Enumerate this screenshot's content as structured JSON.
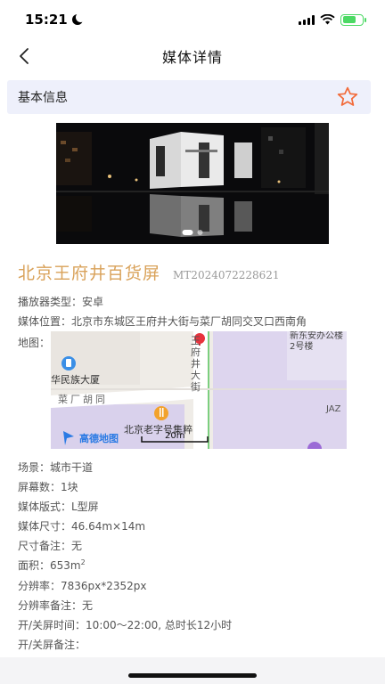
{
  "status": {
    "time": "15:21"
  },
  "nav": {
    "title": "媒体详情"
  },
  "section": {
    "title": "基本信息"
  },
  "media": {
    "name": "北京王府井百货屏",
    "code": "MT2024072228621",
    "name_color": "#d9a25a"
  },
  "info": {
    "player_type": "播放器类型：安卓",
    "location": "媒体位置：北京市东城区王府井大街与菜厂胡同交叉口西南角",
    "map_label": "地图：",
    "scene": "场景：城市干道",
    "screen_count": "屏幕数：1块",
    "format": "媒体版式：L型屏",
    "size": "媒体尺寸：46.64m×14m",
    "size_note": "尺寸备注：无",
    "area_prefix": "面积：653m",
    "area_sup": "2",
    "resolution": "分辨率：7836px*2352px",
    "resolution_note": "分辨率备注：无",
    "hours": "开/关屏时间：10:00～22:00, 总时长12小时",
    "hours_note": "开/关屏备注："
  },
  "map": {
    "road_label": "王府井大街",
    "building_label": "新东安办公楼2号楼",
    "poi_1": "华民族大厦",
    "poi_2": "北京老字号集粹",
    "lane_label": "菜厂胡同",
    "shop_label": "JAZ",
    "logo_text": "高德地图",
    "scale_text": "20m"
  },
  "colors": {
    "accent": "#d9a25a",
    "header_bg": "#eef0fb",
    "star": "#f26b3a"
  }
}
